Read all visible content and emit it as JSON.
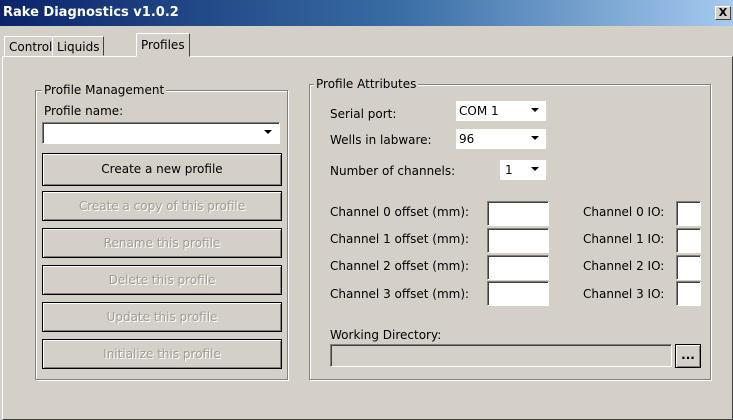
{
  "window": {
    "title": "Rake Diagnostics v1.0.2",
    "close_glyph": "X"
  },
  "tabs": [
    {
      "label": "Controls"
    },
    {
      "label": "Liquids"
    },
    {
      "label": "Profiles"
    }
  ],
  "profile_management": {
    "legend": "Profile Management",
    "profile_name_label": "Profile name:",
    "profile_name_value": "",
    "buttons": [
      {
        "label": "Create a new profile",
        "enabled": true
      },
      {
        "label": "Create a copy of this profile",
        "enabled": false
      },
      {
        "label": "Rename this profile",
        "enabled": false
      },
      {
        "label": "Delete this profile",
        "enabled": false
      },
      {
        "label": "Update this profile",
        "enabled": false
      },
      {
        "label": "Initialize this profile",
        "enabled": false
      }
    ]
  },
  "profile_attributes": {
    "legend": "Profile Attributes",
    "serial_port_label": "Serial port:",
    "serial_port_value": "COM 1",
    "wells_label": "Wells in labware:",
    "wells_value": "96",
    "channels_label": "Number of channels:",
    "channels_value": "1",
    "channels": [
      {
        "offset_label": "Channel 0 offset (mm):",
        "offset_value": "",
        "io_label": "Channel 0 IO:",
        "io_value": ""
      },
      {
        "offset_label": "Channel 1 offset (mm):",
        "offset_value": "",
        "io_label": "Channel 1 IO:",
        "io_value": ""
      },
      {
        "offset_label": "Channel 2 offset (mm):",
        "offset_value": "",
        "io_label": "Channel 2 IO:",
        "io_value": ""
      },
      {
        "offset_label": "Channel 3 offset (mm):",
        "offset_value": "",
        "io_label": "Channel 3 IO:",
        "io_value": ""
      }
    ],
    "working_dir_label": "Working Directory:",
    "working_dir_value": "",
    "browse_label": "..."
  }
}
